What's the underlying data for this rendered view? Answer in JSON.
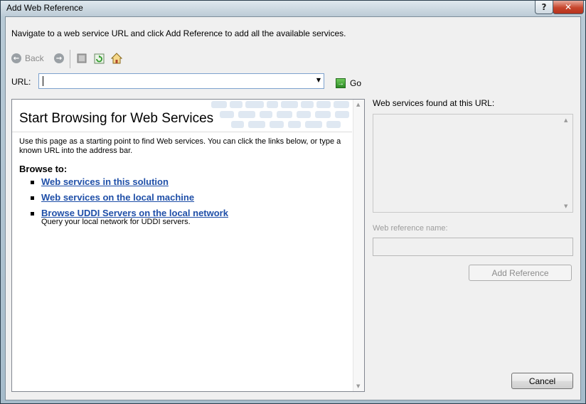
{
  "window": {
    "title": "Add Web Reference",
    "help_glyph": "?",
    "close_glyph": "✕"
  },
  "instructions": "Navigate to a web service URL and click Add Reference to add all the available services.",
  "toolbar": {
    "back_label": "Back",
    "back_icon": "back-arrow-icon",
    "forward_icon": "forward-arrow-icon",
    "stop_icon": "stop-icon",
    "refresh_icon": "refresh-icon",
    "home_icon": "home-icon"
  },
  "url": {
    "label": "URL:",
    "value": "",
    "go_label": "Go"
  },
  "browser": {
    "title": "Start Browsing for Web Services",
    "intro": "Use this page as a starting point to find Web services. You can click the links below, or type a known URL into the address bar.",
    "browse_heading": "Browse to:",
    "links": [
      {
        "label": "Web services in this solution",
        "desc": ""
      },
      {
        "label": "Web services on the local machine",
        "desc": ""
      },
      {
        "label": "Browse UDDI Servers on the local network",
        "desc": "Query your local network for UDDI servers."
      }
    ]
  },
  "right_panel": {
    "found_label": "Web services found at this URL:",
    "ref_name_label": "Web reference name:",
    "ref_name_value": "",
    "add_reference_label": "Add Reference"
  },
  "footer": {
    "cancel_label": "Cancel"
  },
  "colors": {
    "link": "#1f4fa8",
    "close_button": "#c7452c",
    "go_icon": "#2d8a26"
  }
}
